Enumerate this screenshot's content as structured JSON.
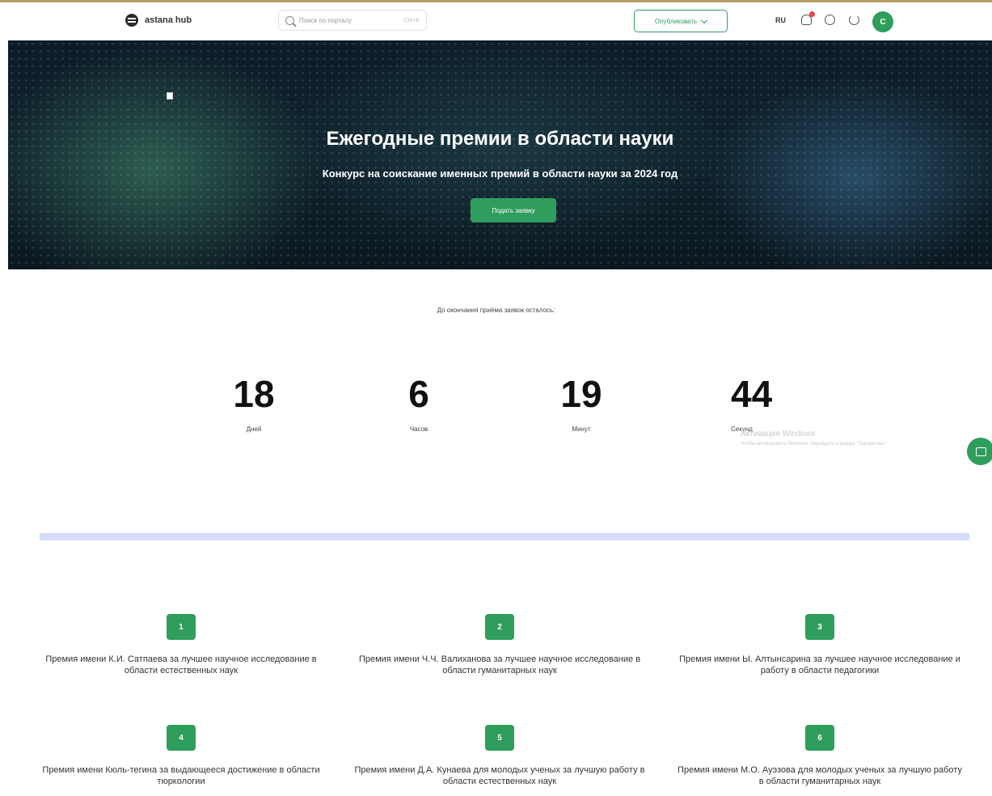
{
  "header": {
    "logo_text": "astana hub",
    "search_placeholder": "Поиск по порталу",
    "search_shortcut": "Ctrl+K",
    "publish_label": "Опубликовать",
    "language": "RU",
    "avatar_letter": "С"
  },
  "hero": {
    "title": "Ежегодные премии в области науки",
    "subtitle": "Конкурс на соискание именных премий в области науки за 2024 год",
    "apply_label": "Подать заявку"
  },
  "countdown": {
    "caption": "До окончания приёма заявок осталось:",
    "items": [
      {
        "value": "18",
        "label": "Дней"
      },
      {
        "value": "6",
        "label": "Часов"
      },
      {
        "value": "19",
        "label": "Минут"
      },
      {
        "value": "44",
        "label": "Секунд"
      }
    ]
  },
  "os_notice": {
    "title": "Активация Windows",
    "text": "Чтобы активировать Windows, перейдите в раздел \"Параметры\"."
  },
  "prizes": [
    {
      "number": "1",
      "text": "Премия имени К.И. Сатпаева за лучшее научное исследование в области естественных наук"
    },
    {
      "number": "2",
      "text": "Премия имени Ч.Ч. Валиханова за лучшее научное исследование в области гуманитарных наук"
    },
    {
      "number": "3",
      "text": "Премия имени Ы. Алтынсарина за лучшее научное исследование и работу в области педагогики"
    },
    {
      "number": "4",
      "text": "Премия имени Кюль-тегина за выдающееся достижение в области тюркологии"
    },
    {
      "number": "5",
      "text": "Премия имени Д.А. Кунаева для молодых ученых за лучшую работу в области естественных наук"
    },
    {
      "number": "6",
      "text": "Премия имени М.О. Ауэзова для молодых ученых за лучшую работу в области гуманитарных наук"
    }
  ],
  "colors": {
    "accent": "#2f9e5c",
    "divider": "#d5dcfb"
  }
}
